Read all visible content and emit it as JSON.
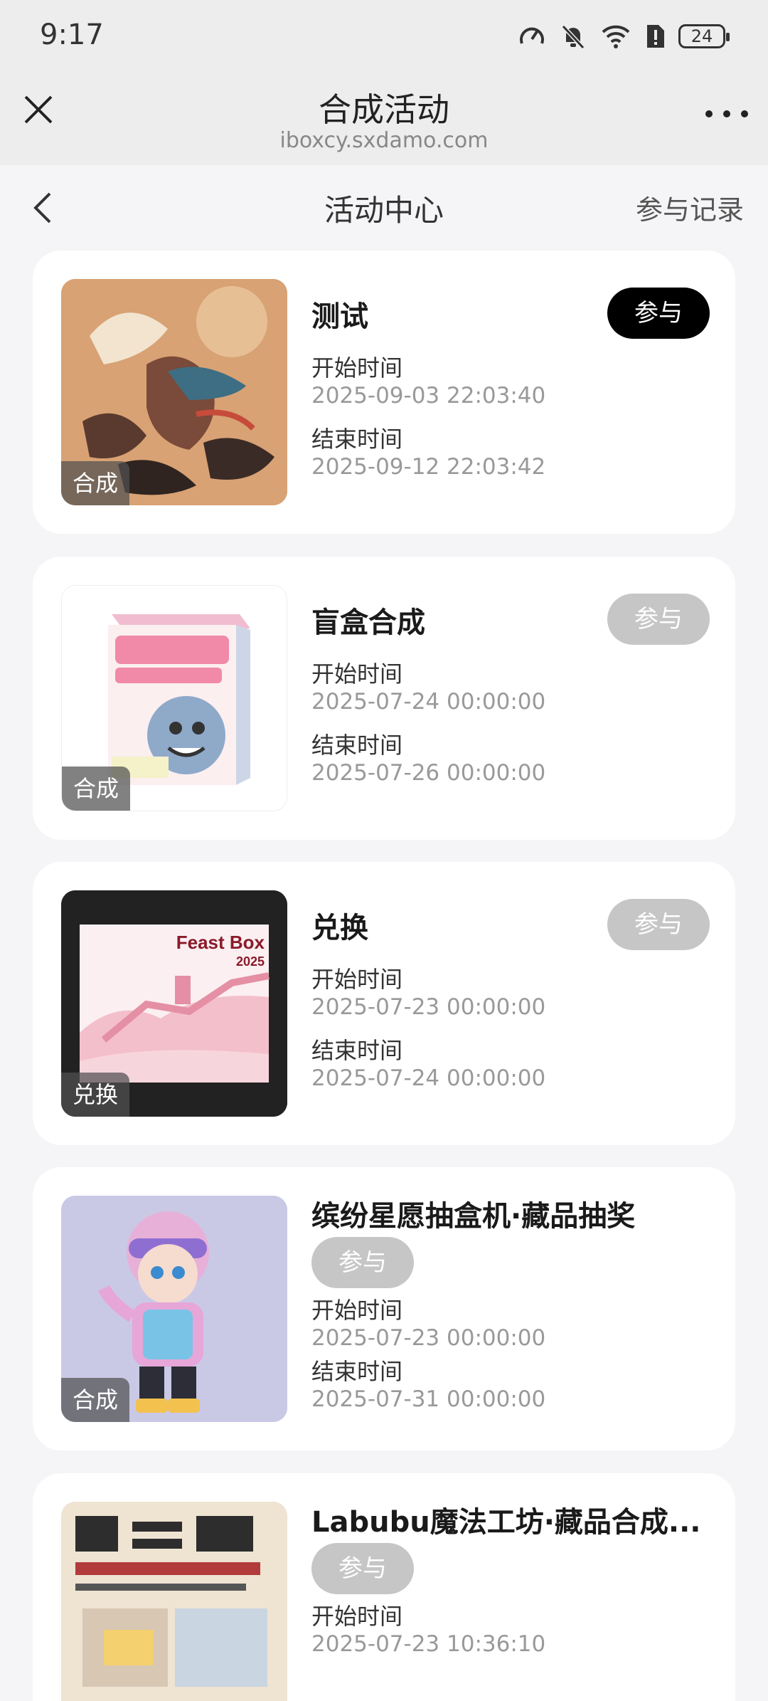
{
  "status_bar": {
    "time": "9:17",
    "battery": "24"
  },
  "browser": {
    "title": "合成活动",
    "url": "iboxcy.sxdamo.com"
  },
  "nav": {
    "title": "活动中心",
    "right_link": "参与记录"
  },
  "labels": {
    "start": "开始时间",
    "end": "结束时间"
  },
  "activities": [
    {
      "title": "测试",
      "tag": "合成",
      "button": "参与",
      "button_active": true,
      "start": "2025-09-03 22:03:40",
      "end": "2025-09-12 22:03:42"
    },
    {
      "title": "盲盒合成",
      "tag": "合成",
      "button": "参与",
      "button_active": false,
      "start": "2025-07-24 00:00:00",
      "end": "2025-07-26 00:00:00"
    },
    {
      "title": "兑换",
      "tag": "兑换",
      "button": "参与",
      "button_active": false,
      "start": "2025-07-23 00:00:00",
      "end": "2025-07-24 00:00:00",
      "image_text": {
        "line1": "Feast Box",
        "line2": "2025"
      }
    },
    {
      "title": "缤纷星愿抽盒机·藏品抽奖",
      "tag": "合成",
      "button": "参与",
      "button_active": false,
      "start": "2025-07-23 00:00:00",
      "end": "2025-07-31 00:00:00"
    },
    {
      "title": "Labubu魔法工坊·藏品合成...",
      "tag": "",
      "button": "参与",
      "button_active": false,
      "start": "2025-07-23 10:36:10",
      "end": ""
    }
  ],
  "colors": {
    "button_active": "#000000",
    "button_disabled": "#c6c6c6",
    "page_bg": "#f5f5f7"
  }
}
